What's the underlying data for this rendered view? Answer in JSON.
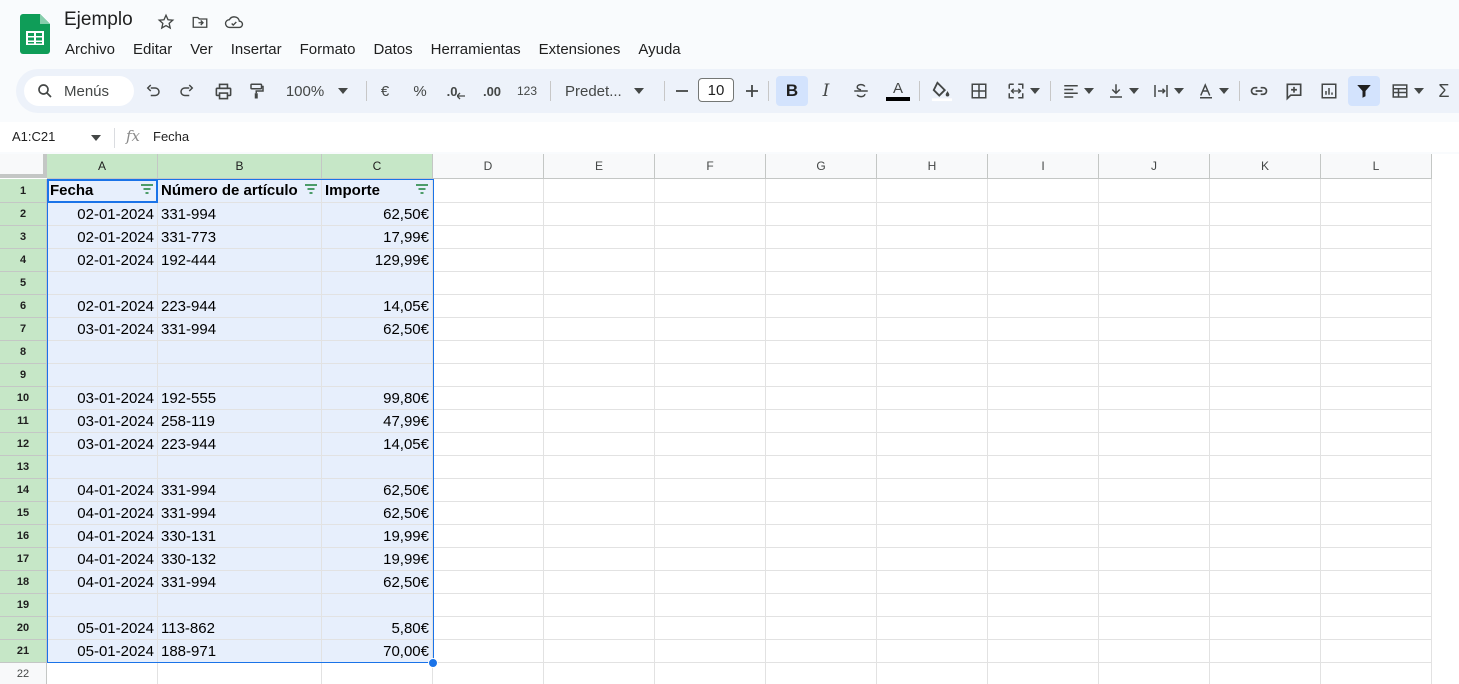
{
  "doc": {
    "title": "Ejemplo"
  },
  "menu": [
    "Archivo",
    "Editar",
    "Ver",
    "Insertar",
    "Formato",
    "Datos",
    "Herramientas",
    "Extensiones",
    "Ayuda"
  ],
  "toolbar": {
    "search_placeholder": "Menús",
    "zoom": "100%",
    "currency": "€",
    "percent": "%",
    "dec_decrease": ".0",
    "dec_increase": ".00",
    "more_formats": "123",
    "font": "Predet...",
    "font_size": "10",
    "bold": "B",
    "italic": "I",
    "text_color": "A",
    "sum": "Σ"
  },
  "formula_bar": {
    "name_box": "A1:C21",
    "fx": "fx",
    "content": "Fecha"
  },
  "columns": [
    "A",
    "B",
    "C",
    "D",
    "E",
    "F",
    "G",
    "H",
    "I",
    "J",
    "K",
    "L"
  ],
  "rows": [
    [
      "Fecha",
      "Número de artículo",
      "Importe"
    ],
    [
      "02-01-2024",
      "331-994",
      "62,50€"
    ],
    [
      "02-01-2024",
      "331-773",
      "17,99€"
    ],
    [
      "02-01-2024",
      "192-444",
      "129,99€"
    ],
    [
      "",
      "",
      ""
    ],
    [
      "02-01-2024",
      "223-944",
      "14,05€"
    ],
    [
      "03-01-2024",
      "331-994",
      "62,50€"
    ],
    [
      "",
      "",
      ""
    ],
    [
      "",
      "",
      ""
    ],
    [
      "03-01-2024",
      "192-555",
      "99,80€"
    ],
    [
      "03-01-2024",
      "258-119",
      "47,99€"
    ],
    [
      "03-01-2024",
      "223-944",
      "14,05€"
    ],
    [
      "",
      "",
      ""
    ],
    [
      "04-01-2024",
      "331-994",
      "62,50€"
    ],
    [
      "04-01-2024",
      "331-994",
      "62,50€"
    ],
    [
      "04-01-2024",
      "330-131",
      "19,99€"
    ],
    [
      "04-01-2024",
      "330-132",
      "19,99€"
    ],
    [
      "04-01-2024",
      "331-994",
      "62,50€"
    ],
    [
      "",
      "",
      ""
    ],
    [
      "05-01-2024",
      "113-862",
      "5,80€"
    ],
    [
      "05-01-2024",
      "188-971",
      "70,00€"
    ],
    [
      "",
      "",
      ""
    ]
  ],
  "colors": {
    "accent": "#1a73e8",
    "selection": "#e7effc",
    "filter_header": "#c6e7c7",
    "logo": "#0f9d58"
  }
}
